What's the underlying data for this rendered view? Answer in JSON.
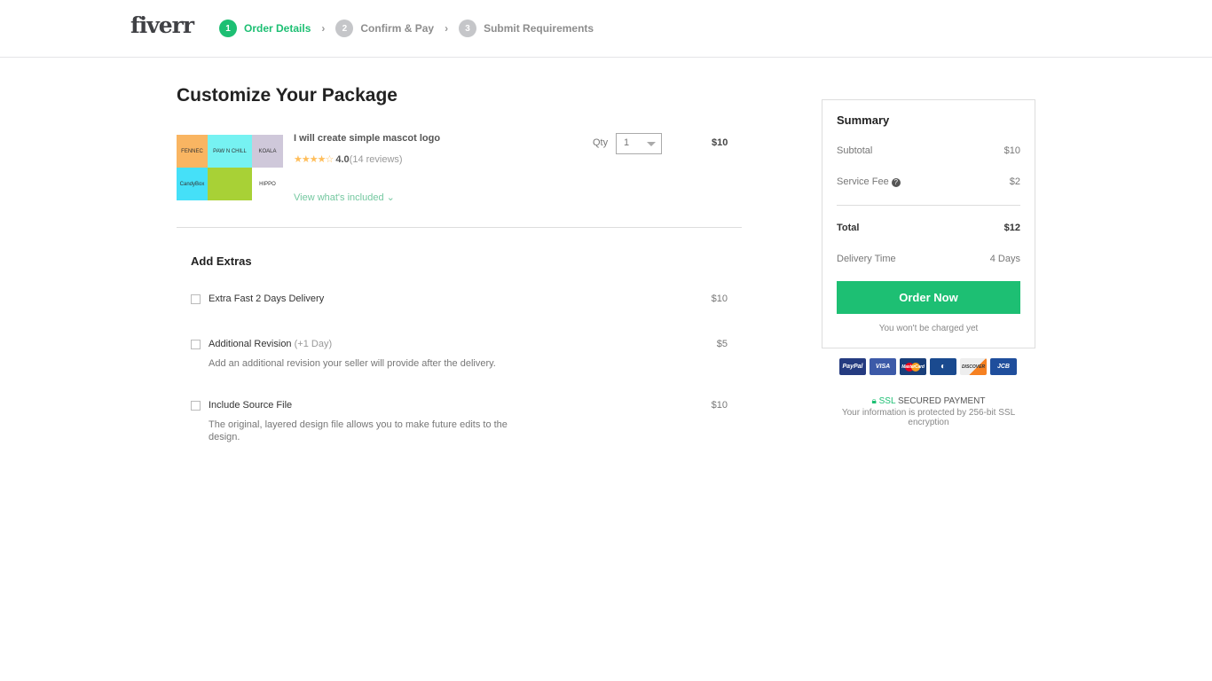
{
  "header": {
    "logo": "fiverr",
    "steps": [
      {
        "num": "1",
        "label": "Order Details",
        "active": true
      },
      {
        "num": "2",
        "label": "Confirm & Pay"
      },
      {
        "num": "3",
        "label": "Submit Requirements"
      }
    ]
  },
  "main": {
    "title": "Customize Your Package",
    "gig": {
      "title": "I will create simple mascot logo",
      "stars": "★★★★☆",
      "rating": "4.0",
      "reviews": "(14 reviews)",
      "view_included": "View what's included ⌄",
      "qty_label": "Qty",
      "qty_value": "1",
      "price": "$10",
      "thumb_labels": [
        "FENNEC",
        "PAW N CHILL",
        "KOALA",
        "CandyBox",
        "",
        "HIPPO"
      ]
    },
    "extras_title": "Add Extras",
    "extras": [
      {
        "label": "Extra Fast 2 Days Delivery",
        "note": "",
        "price": "$10",
        "desc": ""
      },
      {
        "label": "Additional Revision",
        "note": "(+1 Day)",
        "price": "$5",
        "desc": "Add an additional revision your seller will provide after the delivery."
      },
      {
        "label": "Include Source File",
        "note": "",
        "price": "$10",
        "desc": "The original, layered design file allows you to make future edits to the design."
      }
    ]
  },
  "summary": {
    "title": "Summary",
    "subtotal_label": "Subtotal",
    "subtotal": "$10",
    "fee_label": "Service Fee",
    "fee": "$2",
    "total_label": "Total",
    "total": "$12",
    "delivery_label": "Delivery Time",
    "delivery": "4 Days",
    "order_button": "Order Now",
    "not_charged": "You won't be charged yet"
  },
  "payment": {
    "cards": [
      "PayPal",
      "VISA",
      "MasterCard",
      "Diners",
      "DISCOVER",
      "JCB"
    ],
    "ssl": "SSL",
    "secured": "SECURED PAYMENT",
    "info": "Your information is protected by 256-bit SSL encryption"
  },
  "colors": {
    "accent": "#1dbf73"
  }
}
